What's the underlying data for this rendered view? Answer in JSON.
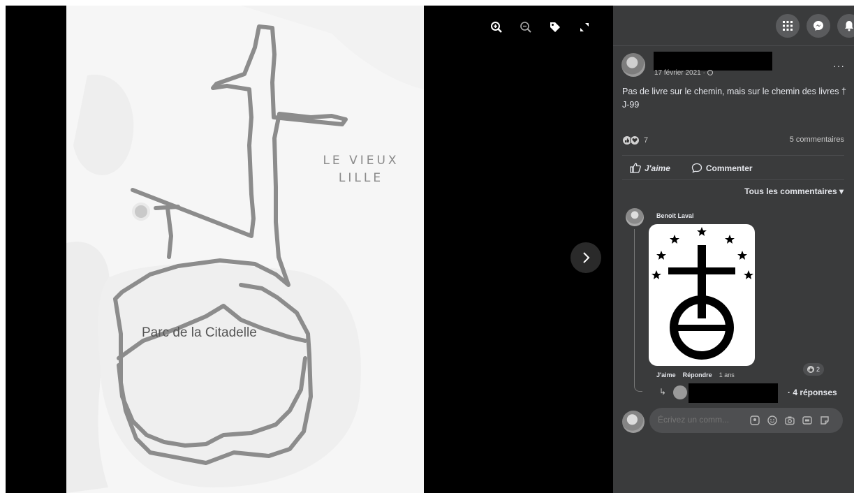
{
  "map": {
    "area_label": "LE VIEUX\nLILLE",
    "park_label": "Parc de la Citadelle"
  },
  "viewer": {
    "tools": [
      "zoom-in",
      "zoom-out",
      "tag",
      "fullscreen"
    ]
  },
  "post": {
    "date": "17 février 2021 · ",
    "text": "Pas de livre sur le chemin, mais sur le chemin des livres † J-99",
    "more": "···",
    "reaction_count": "7",
    "comments_count": "5 commentaires",
    "like_label": "J'aime",
    "comment_label": "Commenter",
    "filter_label": "Tous les commentaires ▾"
  },
  "comment": {
    "author": "Benoit Laval",
    "like": "J'aime",
    "reply": "Répondre",
    "time": "1 ans",
    "reaction_count": "2",
    "replies": "· 4 réponses"
  },
  "composer": {
    "placeholder": "Écrivez un comm..."
  },
  "colors": {
    "panel_bg": "#3a3b3c",
    "track": "#8c8c8c",
    "map_bg": "#f6f6f6"
  }
}
